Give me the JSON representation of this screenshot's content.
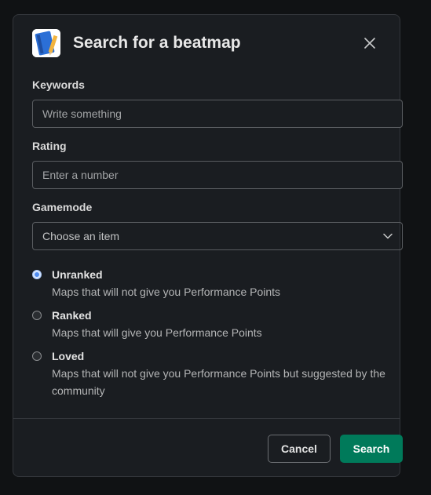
{
  "modal": {
    "title": "Search for a beatmap",
    "app_icon": "notebook-pencil-icon",
    "close_icon": "close-icon"
  },
  "fields": {
    "keywords": {
      "label": "Keywords",
      "value": "",
      "placeholder": "Write something"
    },
    "rating": {
      "label": "Rating",
      "value": "",
      "placeholder": "Enter a number"
    },
    "gamemode": {
      "label": "Gamemode",
      "selected": "Choose an item",
      "icon": "chevron-down-icon"
    }
  },
  "radios": [
    {
      "title": "Unranked",
      "description": "Maps that will not give you Performance Points",
      "checked": true
    },
    {
      "title": "Ranked",
      "description": "Maps that will give you Performance Points",
      "checked": false
    },
    {
      "title": "Loved",
      "description": "Maps that will not give you Performance Points but suggested by the community",
      "checked": false
    }
  ],
  "buttons": {
    "cancel": "Cancel",
    "search": "Search"
  },
  "colors": {
    "primary": "#007a5a",
    "background": "#1a1d21",
    "radio_checked": "#4f8cf0"
  }
}
